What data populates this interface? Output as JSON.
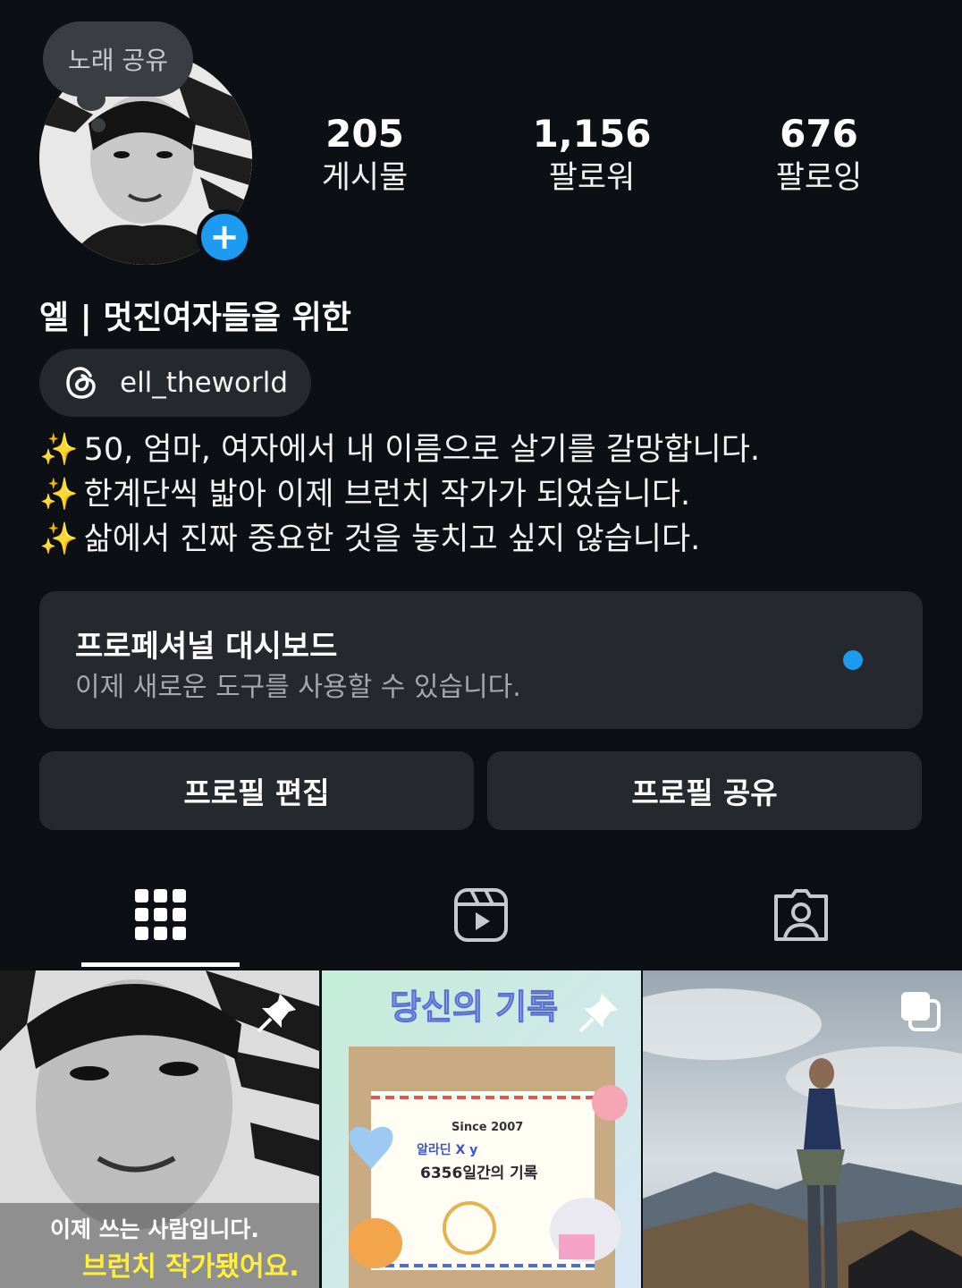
{
  "note": {
    "text": "노래 공유"
  },
  "stats": [
    {
      "value": "205",
      "label": "게시물"
    },
    {
      "value": "1,156",
      "label": "팔로워"
    },
    {
      "value": "676",
      "label": "팔로잉"
    }
  ],
  "profile": {
    "display_name": "엘 | 멋진여자들을 위한",
    "threads_handle": "ell_theworld"
  },
  "bio": {
    "sparkle": "✨",
    "lines": [
      "50, 엄마, 여자에서 내 이름으로 살기를 갈망합니다.",
      "한계단씩 밟아 이제 브런치 작가가 되었습니다.",
      "삶에서 진짜 중요한 것을 놓치고 싶지 않습니다."
    ]
  },
  "dashboard": {
    "title": "프로페셔널 대시보드",
    "subtitle": "이제 새로운 도구를 사용할 수 있습니다.",
    "dot_color": "#1c9bf0"
  },
  "buttons": {
    "edit_profile": "프로필 편집",
    "share_profile": "프로필 공유"
  },
  "tabs": [
    {
      "icon": "grid-icon",
      "active": true
    },
    {
      "icon": "reels-icon",
      "active": false
    },
    {
      "icon": "tagged-icon",
      "active": false
    }
  ],
  "grid": [
    {
      "type": "photo",
      "pinned": true,
      "caption_line1": "이제 쓰는 사람입니다.",
      "caption_line2": "브런치 작가됐어요."
    },
    {
      "type": "illustration",
      "pinned": true,
      "headline": "당신의 기록",
      "since": "Since 2007",
      "brand": "알라딘 X y",
      "record": "6356일간의 기록"
    },
    {
      "type": "photo",
      "multiple": true
    }
  ],
  "colors": {
    "background": "#0c0f14",
    "surface": "#25282d",
    "accent": "#1c9bf0",
    "caption_yellow": "#ffef3a"
  }
}
